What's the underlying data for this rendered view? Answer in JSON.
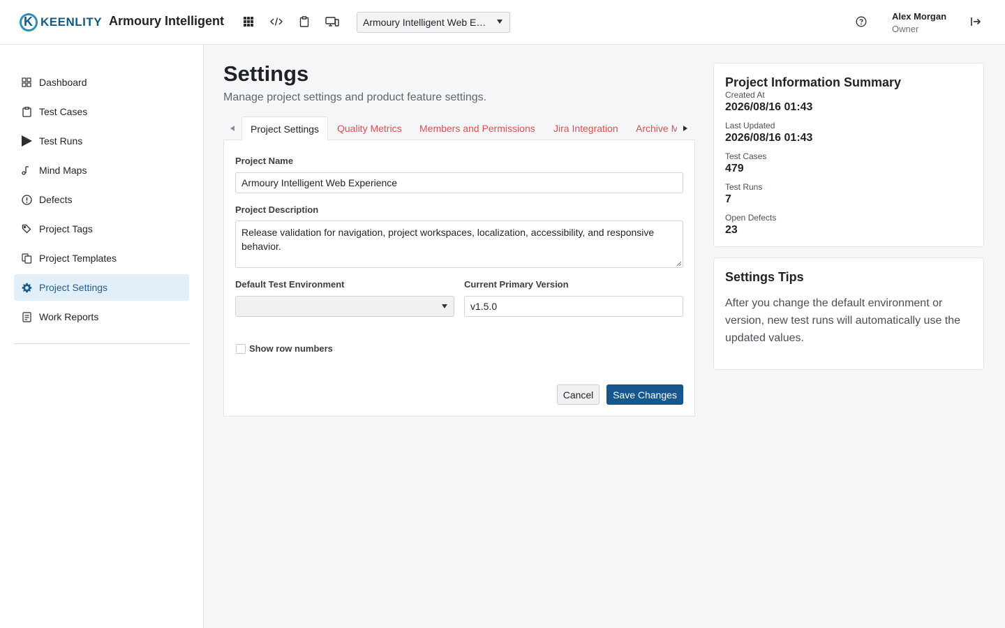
{
  "header": {
    "brand": "KEENLITY",
    "app_name": "Armoury Intelligent",
    "project_select_value": "Armoury Intelligent Web Experience",
    "user_name": "Alex Morgan",
    "user_role": "Owner",
    "icons": [
      "apps-grid-icon",
      "code-icon",
      "clipboard-icon",
      "devices-icon",
      "help-icon",
      "logout-icon"
    ]
  },
  "sidebar": {
    "items": [
      {
        "label": "Dashboard",
        "icon": "dashboard-icon"
      },
      {
        "label": "Test Cases",
        "icon": "clipboard-icon"
      },
      {
        "label": "Test Runs",
        "icon": "play-icon"
      },
      {
        "label": "Mind Maps",
        "icon": "mind-map-icon"
      },
      {
        "label": "Defects",
        "icon": "alert-circle-icon"
      },
      {
        "label": "Project Tags",
        "icon": "tag-icon"
      },
      {
        "label": "Project Templates",
        "icon": "copy-icon"
      },
      {
        "label": "Project Settings",
        "icon": "gear-icon",
        "active": true
      },
      {
        "label": "Work Reports",
        "icon": "report-icon"
      }
    ]
  },
  "main": {
    "title": "Settings",
    "subtitle": "Manage project settings and product feature settings.",
    "tabs": [
      {
        "label": "Project Settings",
        "active": true
      },
      {
        "label": "Quality Metrics"
      },
      {
        "label": "Members and Permissions"
      },
      {
        "label": "Jira Integration"
      },
      {
        "label": "Archive Management"
      }
    ],
    "form": {
      "project_name_label": "Project Name",
      "project_name_value": "Armoury Intelligent Web Experience",
      "description_label": "Project Description",
      "description_value": "Release validation for navigation, project workspaces, localization, accessibility, and responsive behavior.",
      "environment_label": "Default Test Environment",
      "environment_value": "",
      "version_label": "Current Primary Version",
      "version_value": "v1.5.0",
      "show_row_numbers_label": "Show row numbers",
      "show_row_numbers_checked": false,
      "cancel_label": "Cancel",
      "save_label": "Save Changes"
    }
  },
  "summary": {
    "title": "Project Information Summary",
    "created_at_label": "Created At",
    "created_at_value": "2026/08/16 01:43",
    "last_updated_label": "Last Updated",
    "last_updated_value": "2026/08/16 01:43",
    "test_cases_label": "Test Cases",
    "test_cases_value": "479",
    "test_runs_label": "Test Runs",
    "test_runs_value": "7",
    "open_defects_label": "Open Defects",
    "open_defects_value": "23"
  },
  "tips": {
    "title": "Settings Tips",
    "text": "After you change the default environment or version, new test runs will automatically use the updated values."
  },
  "colors": {
    "primary": "#15578f",
    "tab_link": "#d9534f",
    "active_nav_bg": "#e3eff8"
  }
}
